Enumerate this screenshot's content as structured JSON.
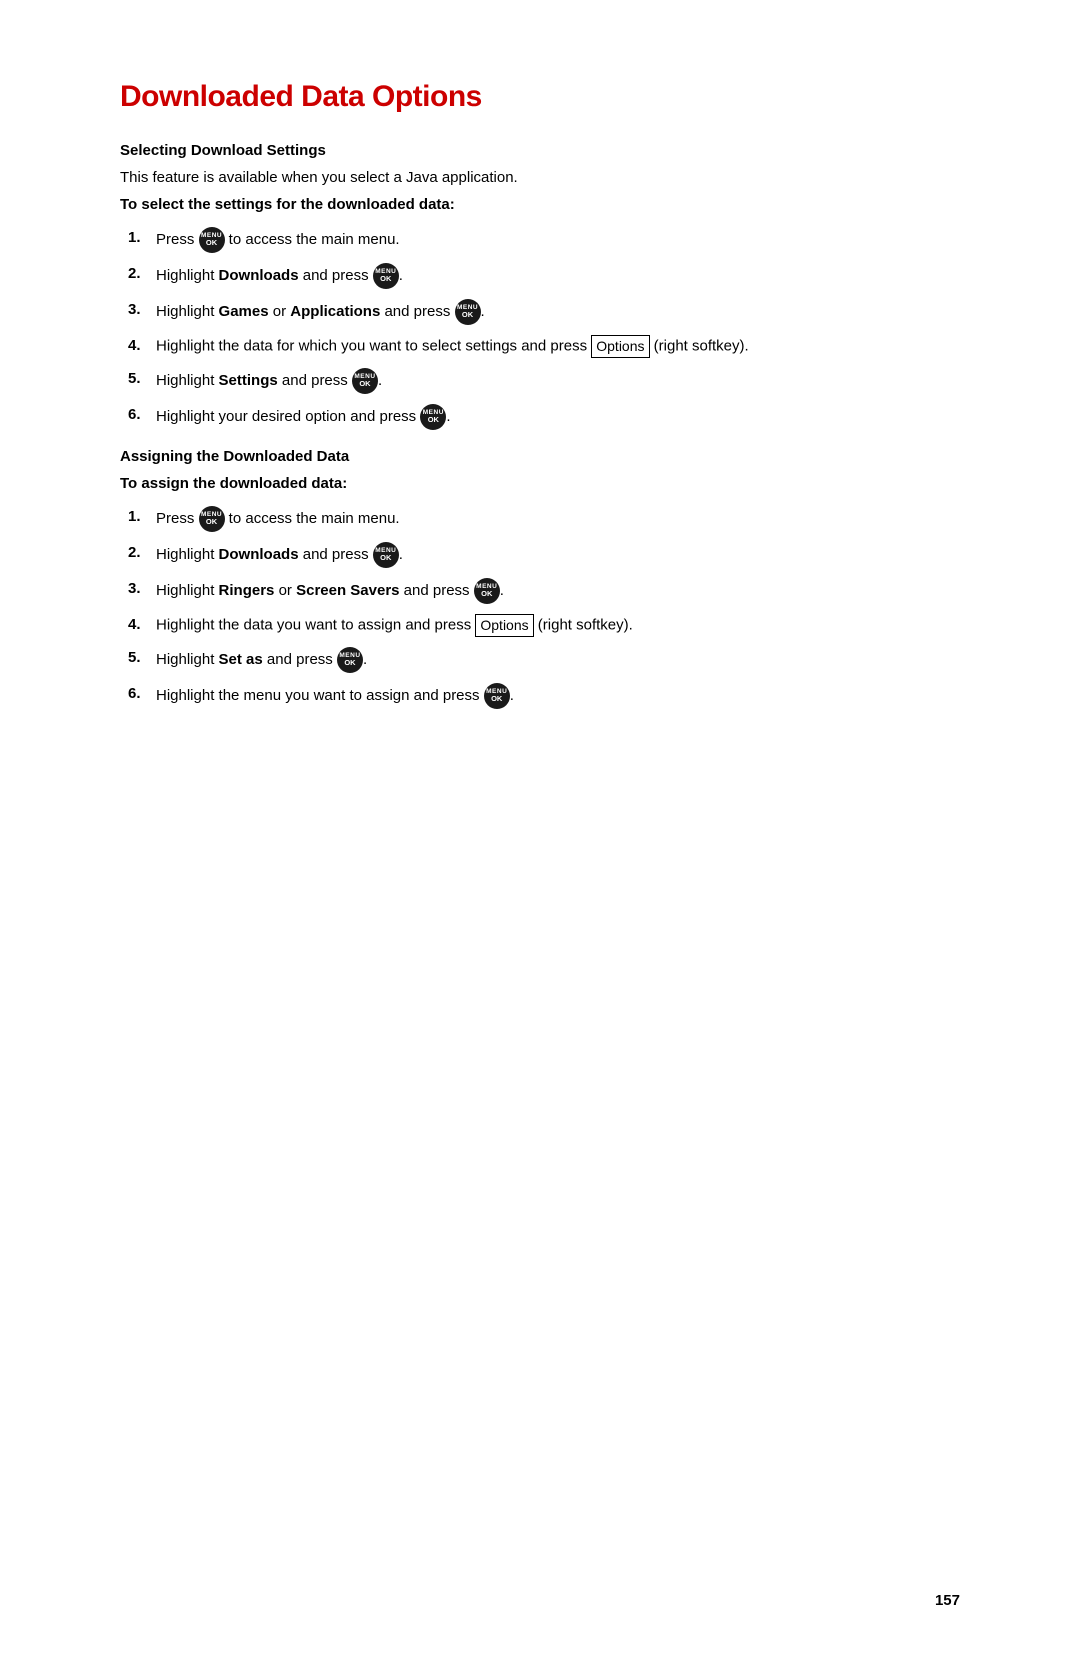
{
  "page": {
    "title": "Downloaded Data Options",
    "page_number": "157"
  },
  "section1": {
    "heading": "Selecting Download Settings",
    "intro": "This feature is available when you select a Java application.",
    "sub_heading": "To select the settings for the downloaded data:",
    "steps": [
      {
        "num": "1.",
        "text_before": "Press ",
        "icon": true,
        "text_after": " to access the main menu."
      },
      {
        "num": "2.",
        "text_before": "Highlight ",
        "bold1": "Downloads",
        "text_mid": " and press ",
        "icon": true,
        "text_after": "."
      },
      {
        "num": "3.",
        "text_before": "Highlight ",
        "bold1": "Games",
        "text_or": " or ",
        "bold2": "Applications",
        "text_mid": " and press ",
        "icon": true,
        "text_after": "."
      },
      {
        "num": "4.",
        "text_before": "Highlight the data for which you want to select settings and press ",
        "options_btn": "Options",
        "text_after": " (right softkey)."
      },
      {
        "num": "5.",
        "text_before": "Highlight ",
        "bold1": "Settings",
        "text_mid": " and press ",
        "icon": true,
        "text_after": "."
      },
      {
        "num": "6.",
        "text_before": "Highlight your desired option and press ",
        "icon": true,
        "text_after": "."
      }
    ]
  },
  "section2": {
    "heading": "Assigning the Downloaded Data",
    "sub_heading": "To assign the downloaded data:",
    "steps": [
      {
        "num": "1.",
        "text_before": "Press ",
        "icon": true,
        "text_after": " to access the main menu."
      },
      {
        "num": "2.",
        "text_before": "Highlight ",
        "bold1": "Downloads",
        "text_mid": " and press ",
        "icon": true,
        "text_after": "."
      },
      {
        "num": "3.",
        "text_before": "Highlight ",
        "bold1": "Ringers",
        "text_or": " or ",
        "bold2": "Screen Savers",
        "text_mid": " and press ",
        "icon": true,
        "text_after": "."
      },
      {
        "num": "4.",
        "text_before": "Highlight the data you want to assign and press ",
        "options_btn": "Options",
        "text_after": " (right softkey)."
      },
      {
        "num": "5.",
        "text_before": "Highlight ",
        "bold1": "Set as",
        "text_mid": " and press ",
        "icon": true,
        "text_after": "."
      },
      {
        "num": "6.",
        "text_before": "Highlight the menu you want to assign and press ",
        "icon": true,
        "text_after": "."
      }
    ]
  }
}
